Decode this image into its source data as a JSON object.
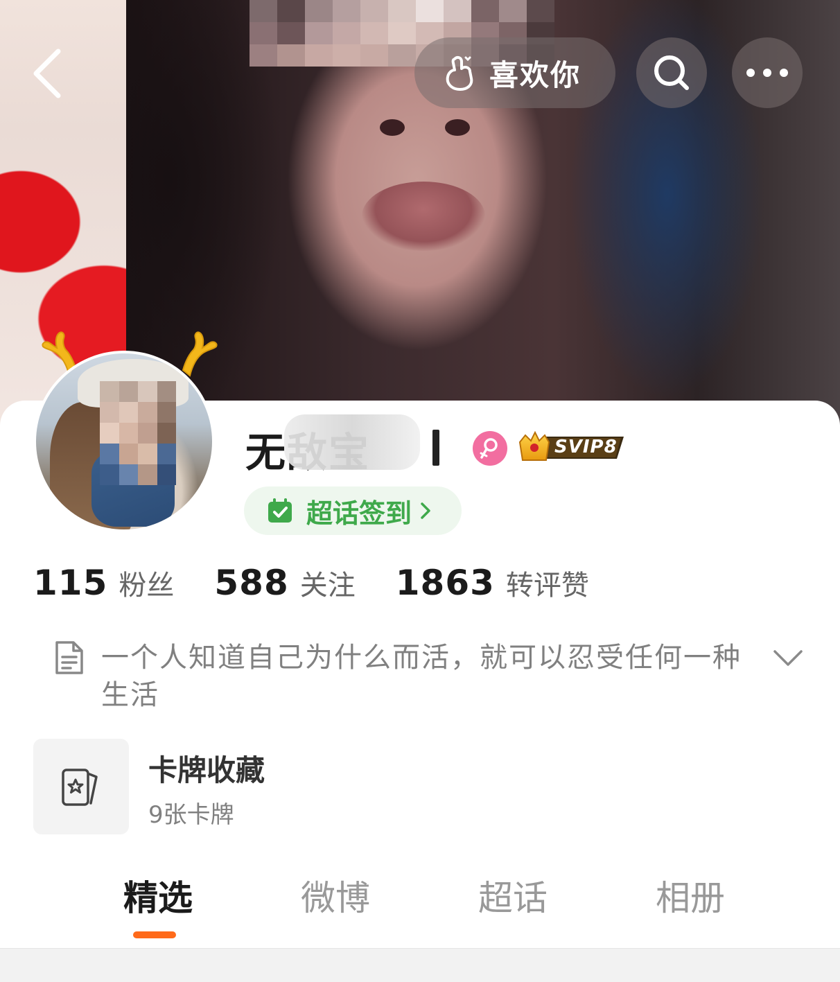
{
  "header": {
    "like_label": "喜欢你"
  },
  "profile": {
    "name": "无敌宝",
    "badge": "SVIP8",
    "checkin_label": "超话签到"
  },
  "stats": [
    {
      "value": "115",
      "label": "粉丝"
    },
    {
      "value": "588",
      "label": "关注"
    },
    {
      "value": "1863",
      "label": "转评赞"
    }
  ],
  "bio": "一个人知道自己为什么而活，就可以忍受任何一种生活",
  "cards": {
    "title": "卡牌收藏",
    "count": "9张卡牌"
  },
  "tabs": [
    {
      "label": "精选",
      "active": true
    },
    {
      "label": "微博",
      "active": false
    },
    {
      "label": "超话",
      "active": false
    },
    {
      "label": "相册",
      "active": false
    }
  ],
  "colors": {
    "accent": "#ff6a1a",
    "checkin_green": "#3fa94b",
    "gender_pink": "#f26ea0",
    "svip_gold": "#f0a81c"
  }
}
